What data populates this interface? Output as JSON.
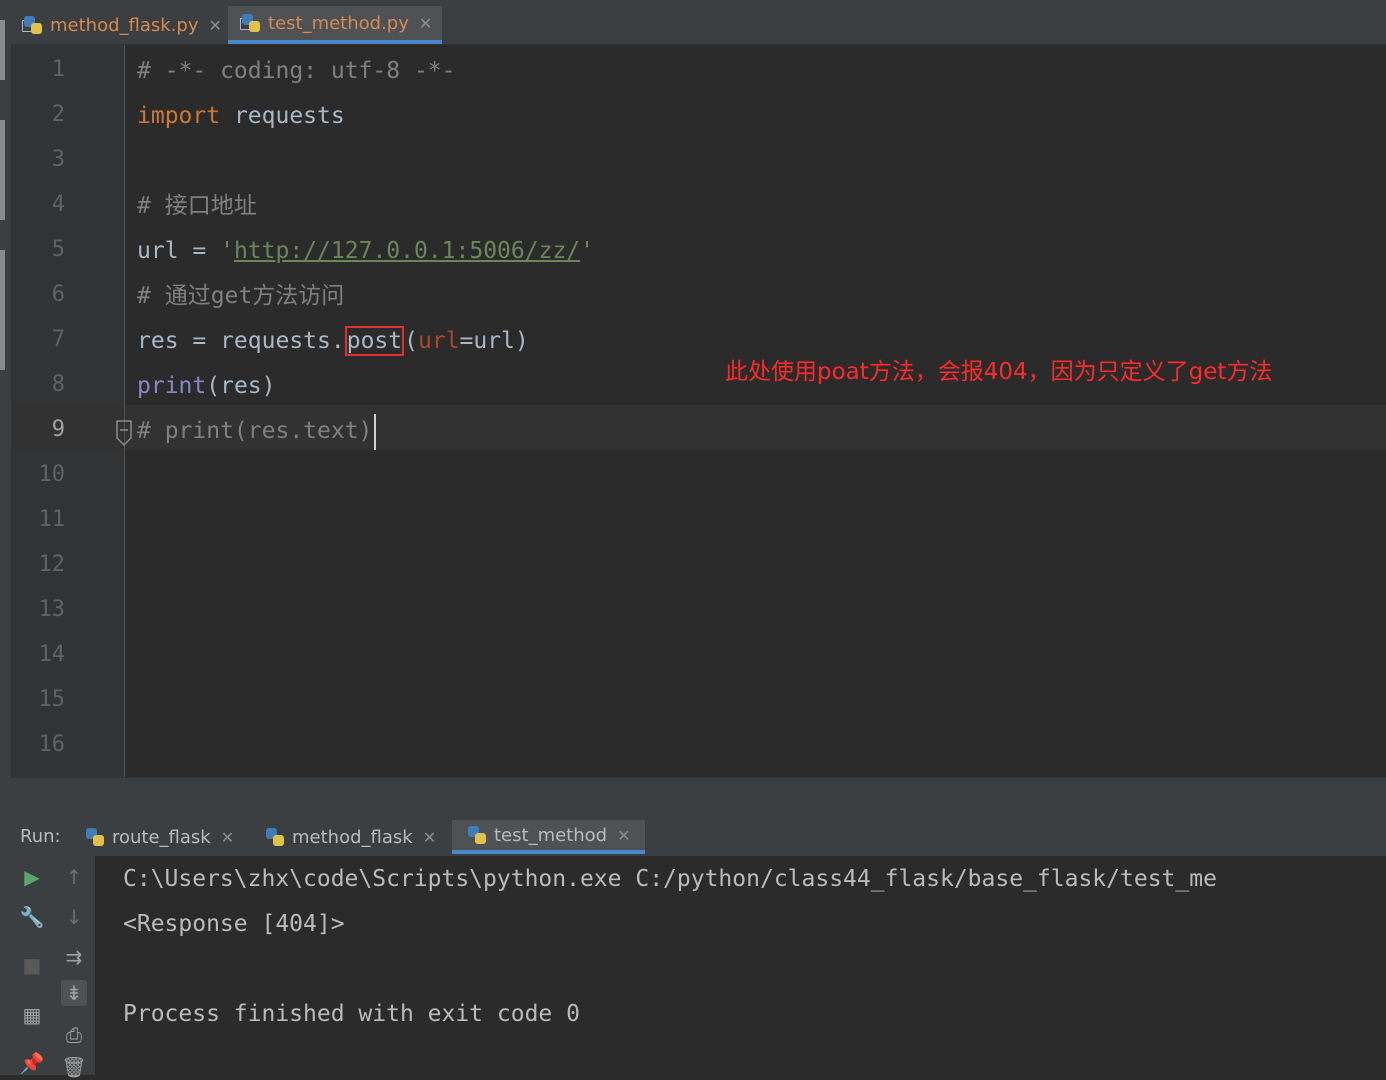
{
  "editor_tabs": [
    {
      "label": "method_flask.py",
      "active": false
    },
    {
      "label": "test_method.py",
      "active": true
    }
  ],
  "line_numbers": [
    "1",
    "2",
    "3",
    "4",
    "5",
    "6",
    "7",
    "8",
    "9",
    "10",
    "11",
    "12",
    "13",
    "14",
    "15",
    "16"
  ],
  "code": {
    "line1": "# -*- coding: utf-8 -*-",
    "line2_kw": "import",
    "line2_rest": " requests",
    "line4": "# 接口地址",
    "line5_var": "url = ",
    "line5_q1": "'",
    "line5_url": "http://127.0.0.1:5006/zz/",
    "line5_q2": "'",
    "line6": "# 通过get方法访问",
    "line7_a": "res = requests.",
    "line7_method": "post",
    "line7_paren": "(",
    "line7_param": "url",
    "line7_rest": "=url)",
    "line8_fn": "print",
    "line8_rest": "(res)",
    "line9": "# print(res.text)"
  },
  "annotation": "此处使用poat方法，会报404，因为只定义了get方法",
  "run_panel": {
    "label": "Run:",
    "tabs": [
      {
        "label": "route_flask",
        "active": false
      },
      {
        "label": "method_flask",
        "active": false
      },
      {
        "label": "test_method",
        "active": true
      }
    ],
    "console": [
      "C:\\Users\\zhx\\code\\Scripts\\python.exe C:/python/class44_flask/base_flask/test_me",
      "<Response [404]>",
      "",
      "Process finished with exit code 0"
    ]
  },
  "colors": {
    "keyword": "#cc7832",
    "comment": "#808080",
    "string": "#6a8759",
    "annotation": "#ff2a2a",
    "highlight_box": "#e0302f",
    "tab_accent": "#4a88c7"
  }
}
